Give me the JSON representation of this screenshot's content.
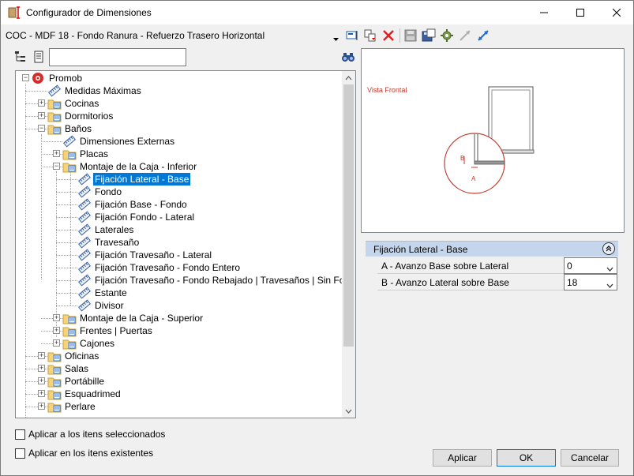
{
  "window": {
    "title": "Configurador de Dimensiones"
  },
  "config": {
    "name": "COC - MDF 18 - Fondo Ranura - Refuerzo Trasero Horizontal"
  },
  "search": {
    "value": ""
  },
  "tree": {
    "nodes": [
      {
        "label": "Promob",
        "type": "root"
      },
      {
        "label": "Medidas Máximas",
        "type": "dim"
      },
      {
        "label": "Cocinas",
        "type": "folder"
      },
      {
        "label": "Dormitorios",
        "type": "folder"
      },
      {
        "label": "Baños",
        "type": "folder"
      },
      {
        "label": "Dimensiones Externas",
        "type": "dim"
      },
      {
        "label": "Placas",
        "type": "folder"
      },
      {
        "label": "Montaje de la Caja - Inferior",
        "type": "folder"
      },
      {
        "label": "Fijación Lateral - Base",
        "type": "dim",
        "selected": true
      },
      {
        "label": "Fondo",
        "type": "dim"
      },
      {
        "label": " Fijación Base - Fondo",
        "type": "dim"
      },
      {
        "label": "Fijación Fondo - Lateral",
        "type": "dim"
      },
      {
        "label": "Laterales",
        "type": "dim"
      },
      {
        "label": "Travesaño",
        "type": "dim"
      },
      {
        "label": "Fijación Travesaño - Lateral",
        "type": "dim"
      },
      {
        "label": "Fijación Travesaño - Fondo Entero",
        "type": "dim"
      },
      {
        "label": "Fijación Travesaño - Fondo Rebajado | Travesaños | Sin Fondo",
        "type": "dim"
      },
      {
        "label": "Estante",
        "type": "dim"
      },
      {
        "label": "Divisor",
        "type": "dim"
      },
      {
        "label": "Montaje de la Caja - Superior",
        "type": "folder"
      },
      {
        "label": "Frentes | Puertas",
        "type": "folder"
      },
      {
        "label": "Cajones",
        "type": "folder"
      },
      {
        "label": "Oficinas",
        "type": "folder"
      },
      {
        "label": "Salas",
        "type": "folder"
      },
      {
        "label": "Portábille",
        "type": "folder"
      },
      {
        "label": "Esquadrimed",
        "type": "folder"
      },
      {
        "label": "Perlare",
        "type": "folder"
      }
    ]
  },
  "preview": {
    "view_label": "Vista Frontal",
    "label_a": "A",
    "label_b": "B"
  },
  "properties": {
    "section_title": "Fijación Lateral - Base",
    "rows": [
      {
        "name": "A - Avanzo Base sobre Lateral",
        "value": "0"
      },
      {
        "name": "B - Avanzo Lateral sobre Base",
        "value": "18"
      }
    ]
  },
  "options": {
    "apply_selected": "Aplicar a los itens seleccionados",
    "apply_existing": "Aplicar en los itens existentes"
  },
  "buttons": {
    "apply": "Aplicar",
    "ok": "OK",
    "cancel": "Cancelar"
  }
}
